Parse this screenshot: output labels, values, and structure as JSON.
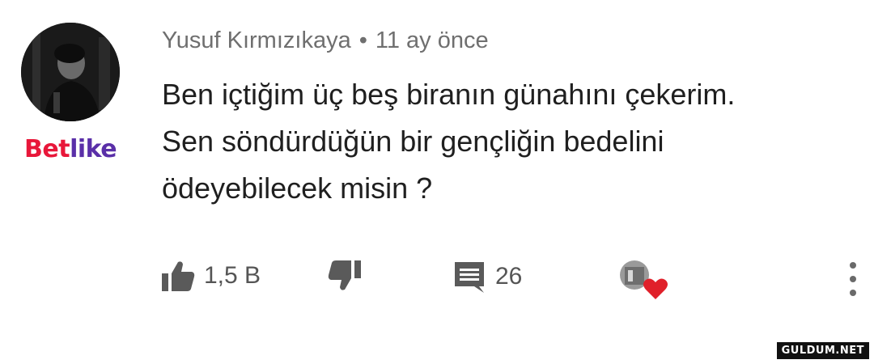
{
  "comment": {
    "author": "Yusuf Kırmızıkaya",
    "separator": "•",
    "time": "11 ay önce",
    "lines": [
      "Ben içtiğim üç beş biranın günahını çekerim.",
      "Sen söndürdüğün bir gençliğin bedelini",
      "ödeyebilecek misin ?"
    ]
  },
  "actions": {
    "like_count": "1,5 B",
    "reply_count": "26",
    "like_icon": "thumbs-up-icon",
    "dislike_icon": "thumbs-down-icon",
    "reply_icon": "comment-icon",
    "creator_heart_icon": "heart-icon",
    "more_icon": "vertical-dots-icon"
  },
  "brand": {
    "part1": "Bet",
    "part2": "like",
    "color1": "#e8173a",
    "color2": "#5a2fa8"
  },
  "watermark": "GULDUM.NET",
  "colors": {
    "text_primary": "#1f1f1f",
    "text_meta": "#6f6f6f",
    "icon_gray": "#5a5a5a",
    "heart_red": "#e0202a"
  }
}
